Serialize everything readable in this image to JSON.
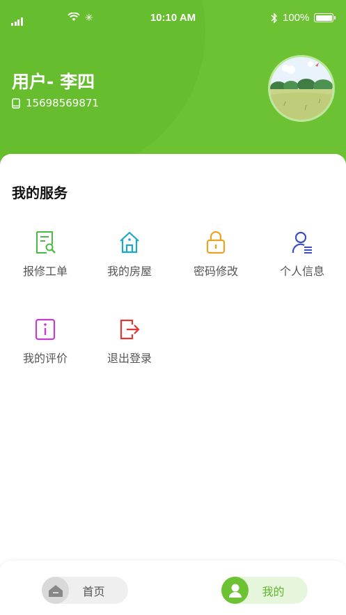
{
  "status_bar": {
    "time": "10:10 AM",
    "battery": "100%"
  },
  "profile": {
    "name": "用户- 李四",
    "phone": "15698569871"
  },
  "services": {
    "title": "我的服务",
    "items": [
      {
        "label": "报修工单",
        "icon": "repair-order-icon",
        "color": "#4cbb46"
      },
      {
        "label": "我的房屋",
        "icon": "house-icon",
        "color": "#1aa7c9"
      },
      {
        "label": "密码修改",
        "icon": "lock-icon",
        "color": "#f0a020"
      },
      {
        "label": "个人信息",
        "icon": "person-info-icon",
        "color": "#3b4fc4"
      },
      {
        "label": "我的评价",
        "icon": "info-icon",
        "color": "#c03dce"
      },
      {
        "label": "退出登录",
        "icon": "logout-icon",
        "color": "#e43434"
      }
    ]
  },
  "tabbar": {
    "home_label": "首页",
    "mine_label": "我的"
  },
  "colors": {
    "brand": "#6cc232"
  }
}
